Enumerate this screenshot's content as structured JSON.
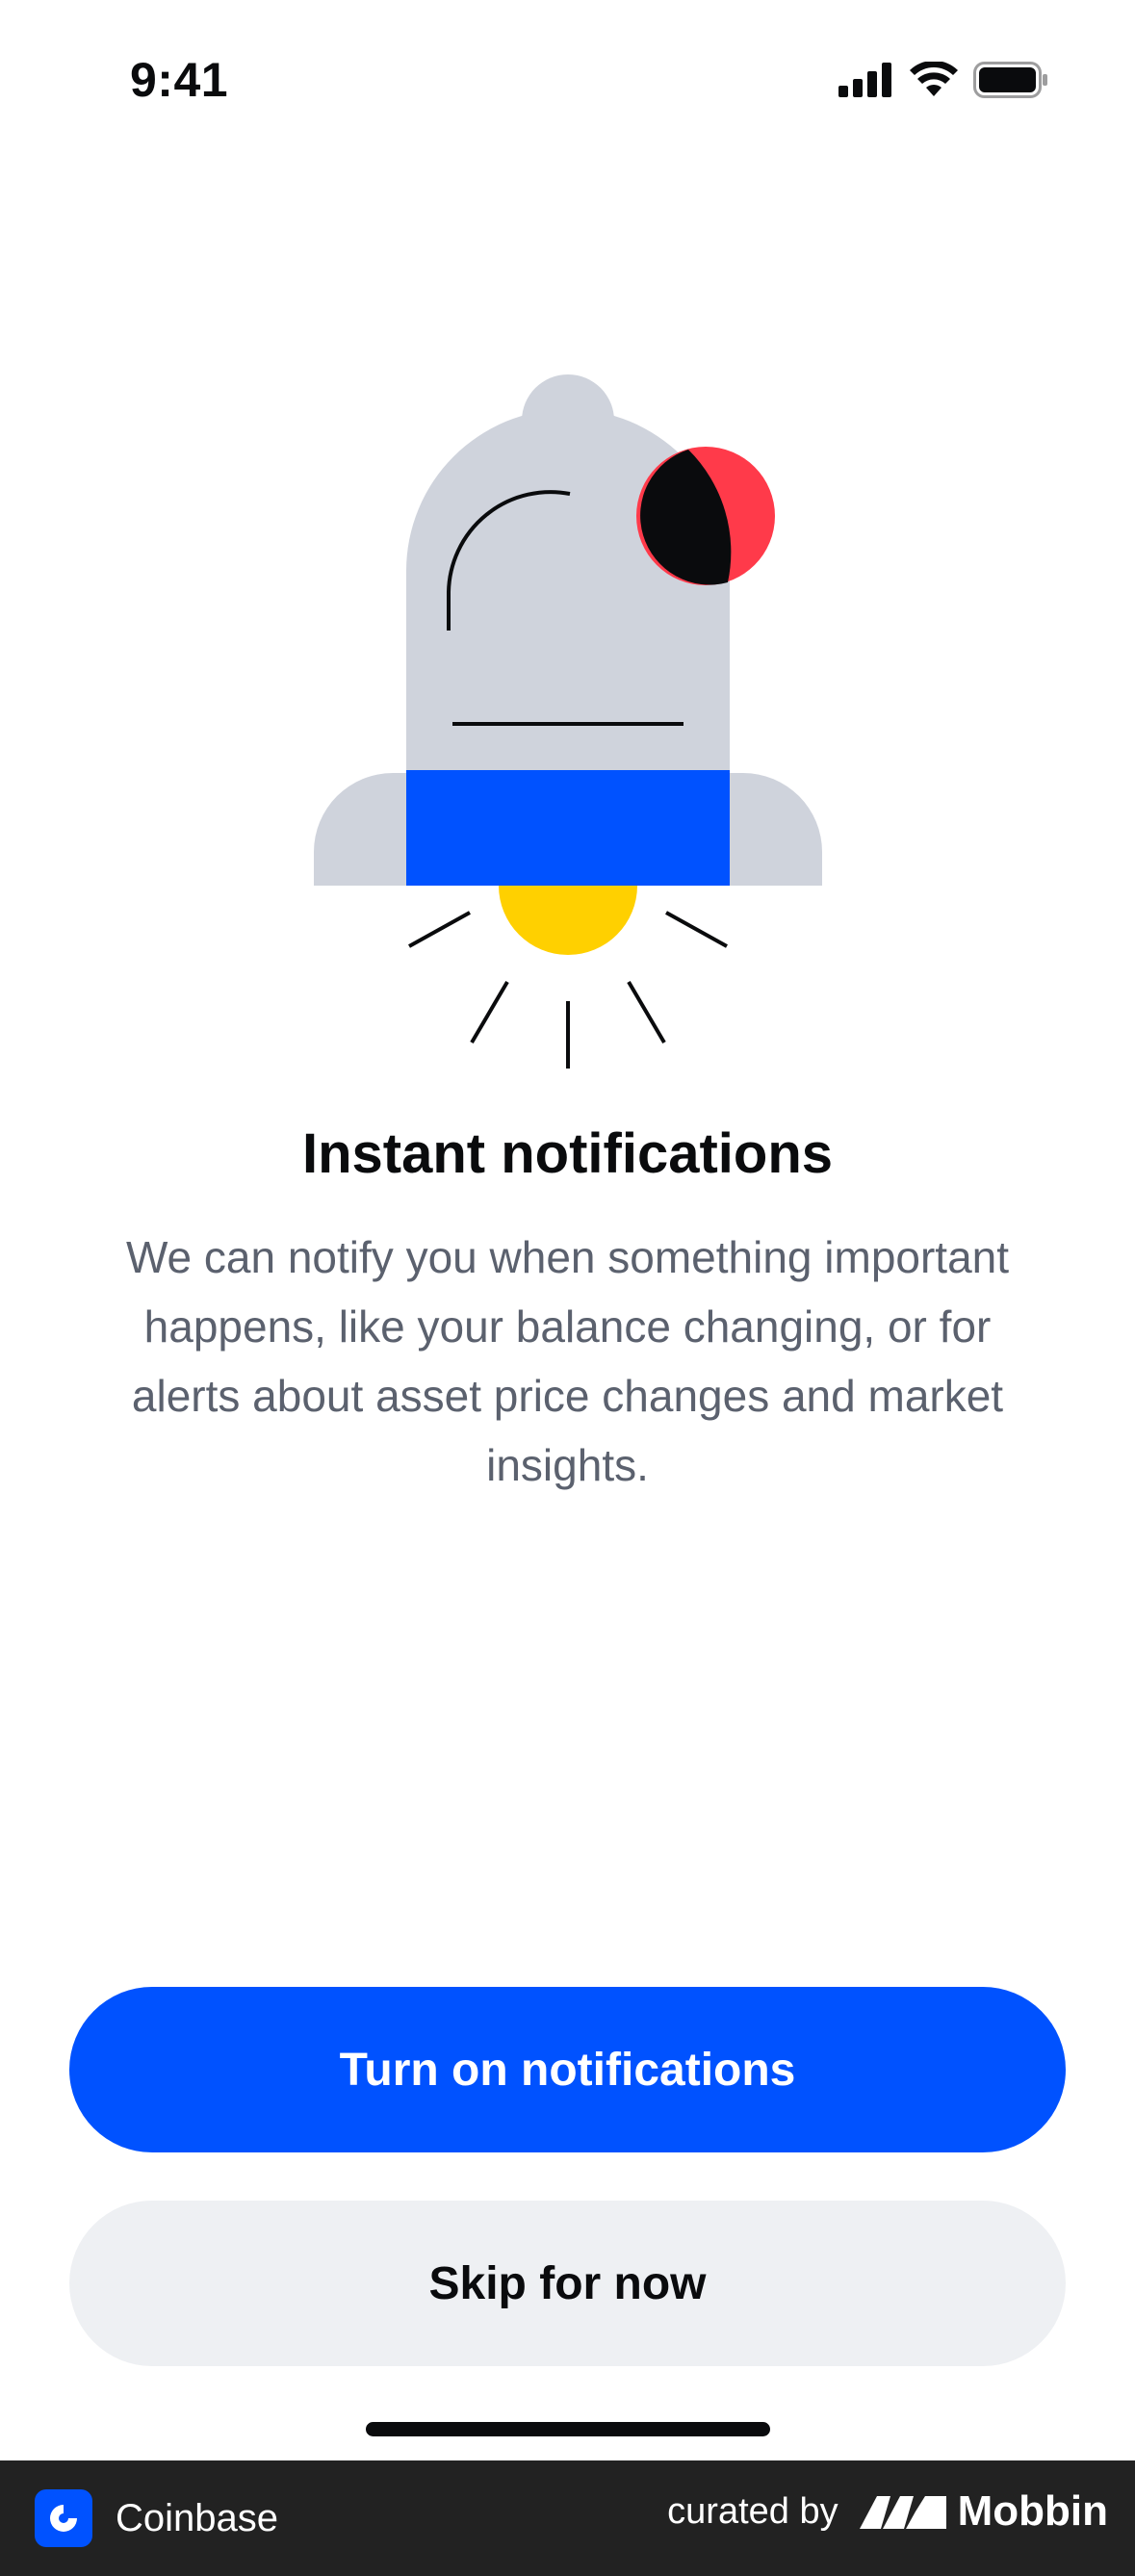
{
  "status_bar": {
    "time": "9:41"
  },
  "onboarding": {
    "illustration_icon": "bell-icon",
    "title": "Instant notifications",
    "description": "We can notify you when something important happens, like your balance changing, or for alerts about asset price changes and market insights."
  },
  "actions": {
    "primary_label": "Turn on notifications",
    "secondary_label": "Skip for now"
  },
  "footer": {
    "app_name": "Coinbase",
    "curated_by": "curated by",
    "brand_name": "Mobbin"
  },
  "colors": {
    "primary_blue": "#0052ff",
    "secondary_gray": "#eef0f3",
    "bell_gray": "#cfd3dc",
    "badge_red": "#ff3a4a",
    "light_yellow": "#ffd000",
    "body_text": "#5b616e"
  }
}
